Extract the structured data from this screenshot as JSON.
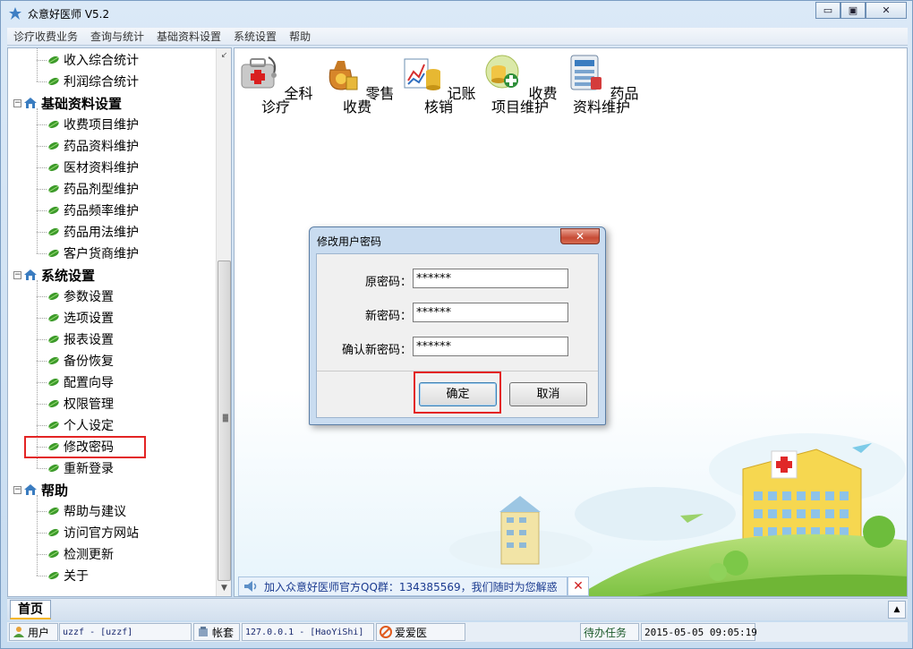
{
  "window": {
    "title": "众意好医师 V5.2",
    "controls": {
      "minimize": "▭",
      "maximize": "▣",
      "close": "✕"
    }
  },
  "menubar": [
    "诊疗收费业务",
    "查询与统计",
    "基础资料设置",
    "系统设置",
    "帮助"
  ],
  "tree": {
    "rows": [
      {
        "type": "child",
        "label": "收入综合统计"
      },
      {
        "type": "child",
        "label": "利润综合统计"
      },
      {
        "type": "group",
        "label": "基础资料设置"
      },
      {
        "type": "child",
        "label": "收费项目维护"
      },
      {
        "type": "child",
        "label": "药品资料维护"
      },
      {
        "type": "child",
        "label": "医材资料维护"
      },
      {
        "type": "child",
        "label": "药品剂型维护"
      },
      {
        "type": "child",
        "label": "药品频率维护"
      },
      {
        "type": "child",
        "label": "药品用法维护"
      },
      {
        "type": "child",
        "label": "客户货商维护"
      },
      {
        "type": "group",
        "label": "系统设置"
      },
      {
        "type": "child",
        "label": "参数设置"
      },
      {
        "type": "child",
        "label": "选项设置"
      },
      {
        "type": "child",
        "label": "报表设置"
      },
      {
        "type": "child",
        "label": "备份恢复"
      },
      {
        "type": "child",
        "label": "配置向导"
      },
      {
        "type": "child",
        "label": "权限管理"
      },
      {
        "type": "child",
        "label": "个人设定"
      },
      {
        "type": "child",
        "label": "修改密码"
      },
      {
        "type": "child",
        "label": "重新登录"
      },
      {
        "type": "group",
        "label": "帮助"
      },
      {
        "type": "child",
        "label": "帮助与建议"
      },
      {
        "type": "child",
        "label": "访问官方网站"
      },
      {
        "type": "child",
        "label": "检测更新"
      },
      {
        "type": "child",
        "label": "关于"
      }
    ],
    "highlighted": "修改密码"
  },
  "toolbar": [
    {
      "label": "全科诊疗",
      "icon": "medical-kit-icon"
    },
    {
      "label": "零售收费",
      "icon": "money-bag-icon"
    },
    {
      "label": "记账核销",
      "icon": "ledger-chart-icon"
    },
    {
      "label": "收费项目维护",
      "icon": "coins-plus-icon"
    },
    {
      "label": "药品资料维护",
      "icon": "drug-database-icon"
    }
  ],
  "notice": {
    "text": "加入众意好医师官方QQ群：134385569，我们随时为您解惑",
    "close": "✕"
  },
  "dialog": {
    "title": "修改用户密码",
    "close": "✕",
    "fields": [
      {
        "label": "原密码：",
        "value": "******"
      },
      {
        "label": "新密码：",
        "value": "******"
      },
      {
        "label": "确认新密码：",
        "value": "******"
      }
    ],
    "ok": "确定",
    "cancel": "取消"
  },
  "tabs": {
    "home": "首页",
    "scroll": "▲"
  },
  "statusbar": {
    "user_label": "用户",
    "user_value": "uzzf - [uzzf]",
    "account_label": "帐套",
    "server": "127.0.0.1 - [HaoYiShi]",
    "brand": "爱爱医",
    "tasks": "待办任务",
    "datetime": "2015-05-05 09:05:19"
  },
  "colors": {
    "highlight": "#e32424",
    "notice_text": "#1a3a8f",
    "leaf": "#3c9a2a"
  }
}
